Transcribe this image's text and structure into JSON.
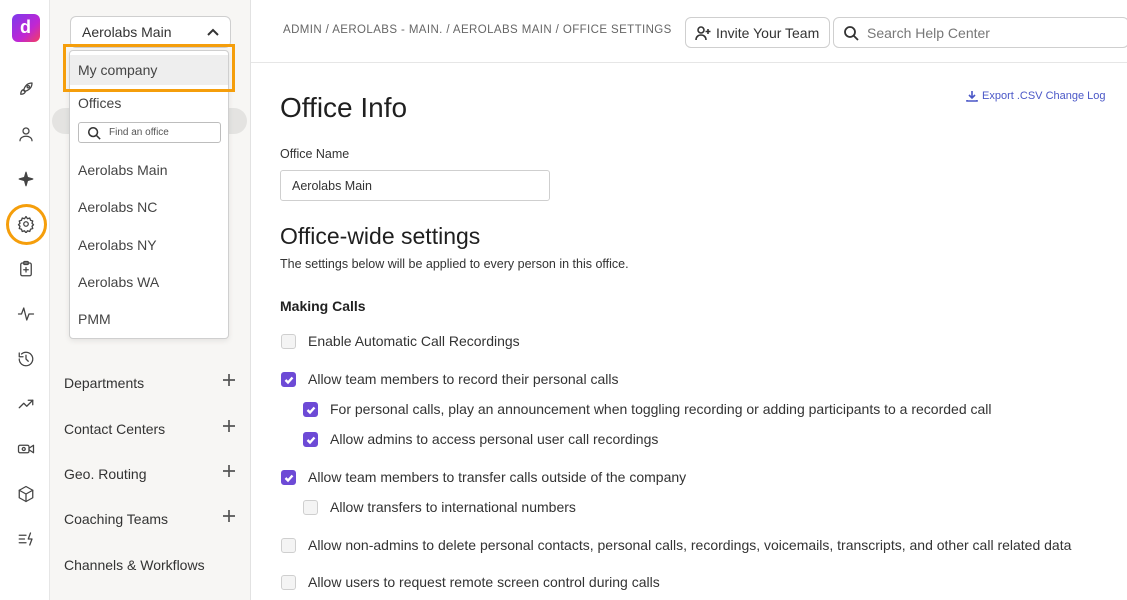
{
  "rail": {
    "logo_letter": "d",
    "icons": [
      "rocket-icon",
      "person-icon",
      "sparkle-icon",
      "gear-icon",
      "clipboard-icon",
      "activity-icon",
      "history-icon",
      "trend-icon",
      "video-settings-icon",
      "cube-icon",
      "list-bolt-icon"
    ],
    "highlight_color": "#f59e0b"
  },
  "sidebar": {
    "office_selector": "Aerolabs Main",
    "items": [
      {
        "label": "Departments"
      },
      {
        "label": "Contact Centers"
      },
      {
        "label": "Geo. Routing"
      },
      {
        "label": "Coaching Teams"
      },
      {
        "label": "Channels & Workflows"
      }
    ]
  },
  "dropdown": {
    "company": "My company",
    "offices_label": "Offices",
    "search_placeholder": "Find an office",
    "offices": [
      "Aerolabs Main",
      "Aerolabs NC",
      "Aerolabs NY",
      "Aerolabs WA",
      "PMM"
    ]
  },
  "header": {
    "breadcrumb": "ADMIN / AEROLABS - MAIN. / AEROLABS MAIN / OFFICE SETTINGS",
    "invite_label": "Invite Your Team",
    "search_placeholder": "Search Help Center"
  },
  "main": {
    "export_link": "Export .CSV Change Log",
    "title": "Office Info",
    "office_name_label": "Office Name",
    "office_name_value": "Aerolabs Main",
    "section_title": "Office-wide settings",
    "section_subtitle": "The settings below will be applied to every person in this office.",
    "subsection": "Making Calls",
    "options": [
      {
        "label": "Enable Automatic Call Recordings",
        "checked": false
      },
      {
        "label": "Allow team members to record their personal calls",
        "checked": true
      },
      {
        "label": "For personal calls, play an announcement when toggling recording or adding participants to a recorded call",
        "checked": true
      },
      {
        "label": "Allow admins to access personal user call recordings",
        "checked": true
      },
      {
        "label": "Allow team members to transfer calls outside of the company",
        "checked": true
      },
      {
        "label": "Allow transfers to international numbers",
        "checked": false
      },
      {
        "label": "Allow non-admins to delete personal contacts, personal calls, recordings, voicemails, transcripts, and other call related data",
        "checked": false
      },
      {
        "label": "Allow users to request remote screen control during calls",
        "checked": false
      }
    ],
    "accent_color": "#6d4ad6"
  }
}
